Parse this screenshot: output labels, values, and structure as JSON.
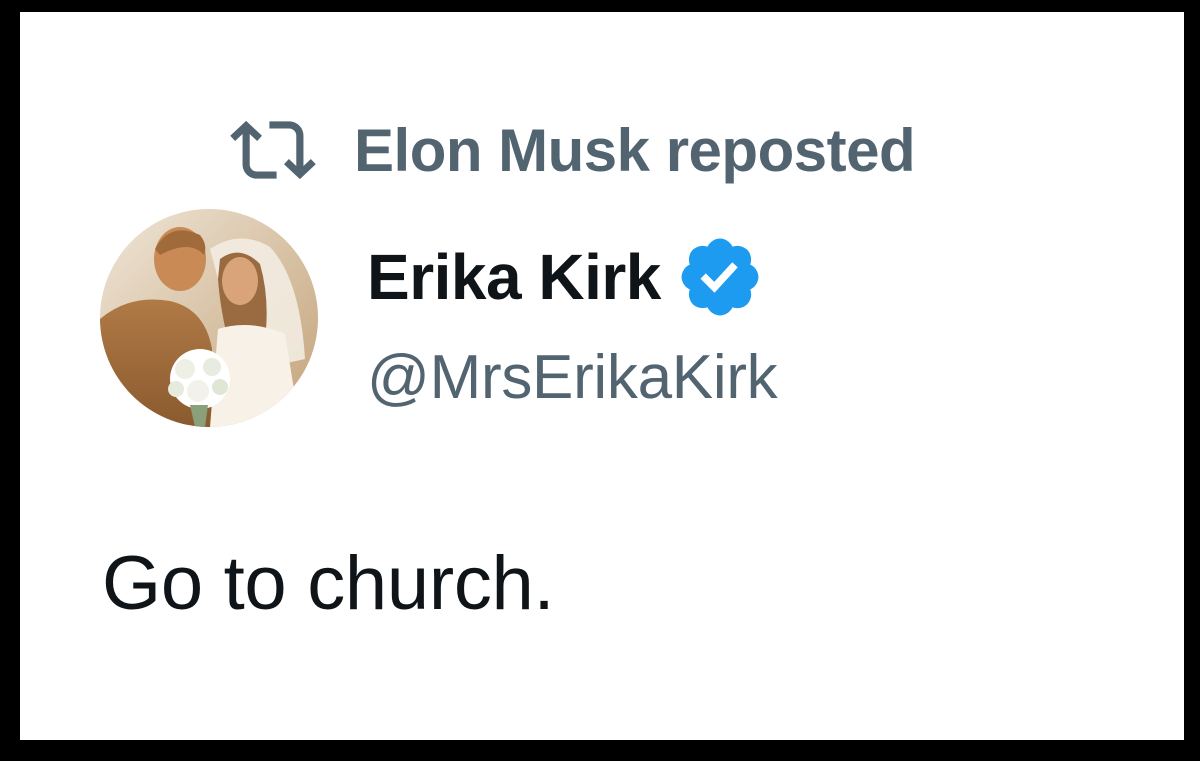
{
  "colors": {
    "frame": "#000000",
    "card_background": "#ffffff",
    "secondary_text": "#536471",
    "primary_text": "#0f1419",
    "verified_blue": "#1d9bf0"
  },
  "repost": {
    "icon": "repost-icon",
    "label": "Elon Musk reposted"
  },
  "author": {
    "avatar": "avatar",
    "name": "Erika Kirk",
    "verified": true,
    "verified_icon": "verified-badge-icon",
    "handle": "@MrsErikaKirk"
  },
  "tweet": {
    "text": "Go to church."
  }
}
